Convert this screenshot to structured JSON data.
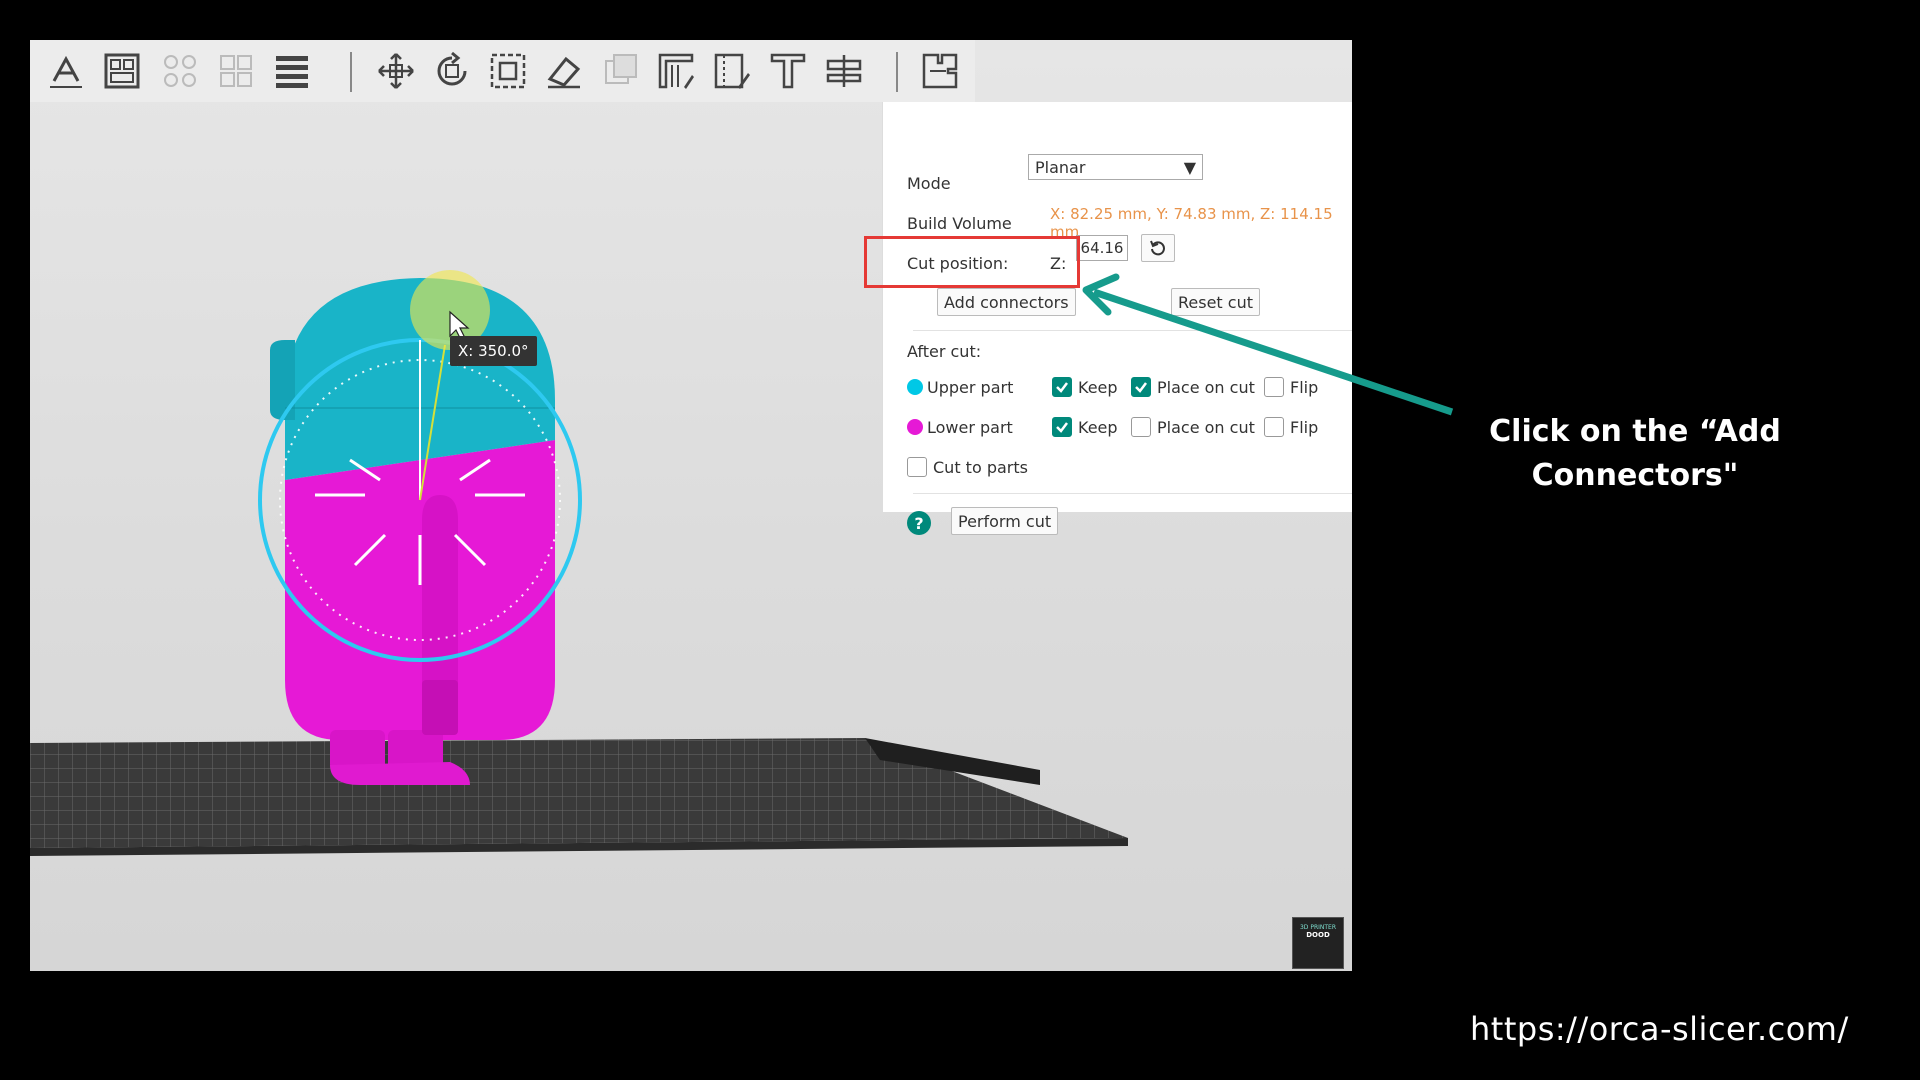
{
  "toolbar": {
    "icons": [
      "text-edit-icon",
      "layout-icon",
      "arrange-icon",
      "split-objects-icon",
      "layers-icon",
      "move-icon",
      "rotate-icon",
      "scale-icon",
      "lay-on-face-icon",
      "boolean-icon",
      "support-paint-icon",
      "seam-paint-icon",
      "text-tool-icon",
      "measure-icon",
      "cut-icon"
    ]
  },
  "panel": {
    "mode_label": "Mode",
    "mode_value": "Planar",
    "build_volume_label": "Build Volume",
    "build_volume_value": "X: 82.25 mm,  Y: 74.83 mm,  Z: 114.15 mm",
    "cut_position_label": "Cut position:",
    "cut_axis": "Z:",
    "cut_value": "64.16",
    "add_connectors_label": "Add connectors",
    "reset_cut_label": "Reset cut",
    "after_cut_label": "After cut:",
    "upper_part_label": "Upper part",
    "lower_part_label": "Lower part",
    "keep_label": "Keep",
    "place_on_cut_label": "Place on cut",
    "flip_label": "Flip",
    "cut_to_parts_label": "Cut to parts",
    "perform_cut_label": "Perform cut",
    "upper_keep": true,
    "upper_place_on_cut": true,
    "upper_flip": false,
    "lower_keep": true,
    "lower_place_on_cut": false,
    "lower_flip": false,
    "cut_to_parts": false,
    "colors": {
      "upper": "#00c8e6",
      "lower": "#e619d6",
      "accent": "#00897b",
      "build_volume": "#e8934a"
    }
  },
  "viewport": {
    "angle_tooltip": "X: 350.0°"
  },
  "annotation": {
    "caption": "Click on the “Add Connectors\"",
    "url": "https://orca-slicer.com/"
  },
  "watermark": {
    "line1": "3D PRINTER",
    "line2": "DOOD"
  }
}
